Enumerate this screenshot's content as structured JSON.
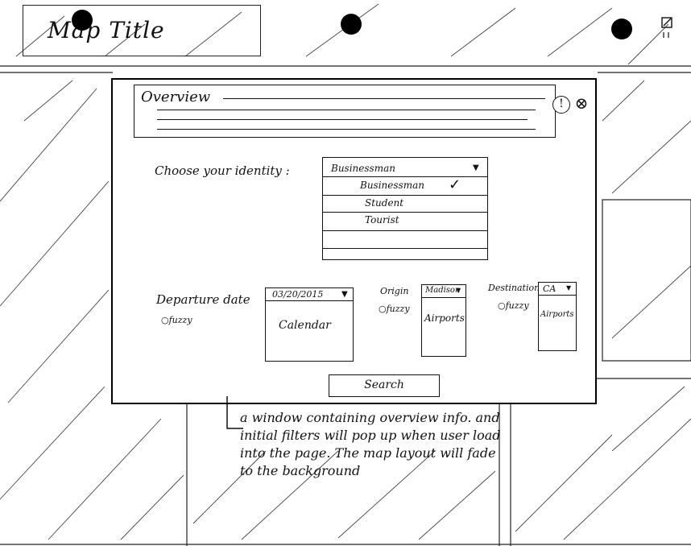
{
  "header": {
    "map_title": "Map Title",
    "corner_icon": "expand-icon"
  },
  "modal": {
    "overview_title": "Overview",
    "help_glyph": "!",
    "close_glyph": "⊗",
    "identity": {
      "label": "Choose your identity :",
      "selected": "Businessman",
      "options": [
        "Businessman",
        "Student",
        "Tourist"
      ],
      "check_glyph": "✓"
    },
    "departure": {
      "label": "Departure date",
      "fuzzy": "fuzzy",
      "date_value": "03/20/2015",
      "calendar_label": "Calendar"
    },
    "origin": {
      "label": "Origin",
      "fuzzy": "fuzzy",
      "selected": "Madison",
      "list_label": "Airports"
    },
    "destination": {
      "label": "Destination",
      "fuzzy": "fuzzy",
      "selected": "CA",
      "list_label": "Airports"
    },
    "search_label": "Search"
  },
  "annotation": {
    "text": "a window containing overview info. and initial filters will pop up when user load into the page. The map layout will fade to the background"
  }
}
